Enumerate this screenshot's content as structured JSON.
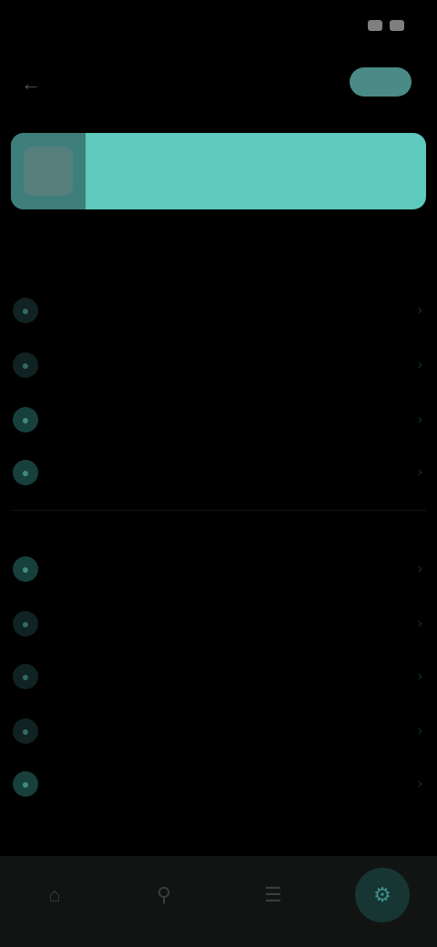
{
  "status_bar": {
    "time": "",
    "icons": [
      "signal-icon",
      "battery-icon"
    ]
  },
  "header": {
    "title": "",
    "action_label": ""
  },
  "current": {
    "label": ""
  },
  "sections": [
    {
      "header": "",
      "items": [
        {
          "label": "",
          "icon": "circle-icon"
        },
        {
          "label": "",
          "icon": "circle-icon"
        },
        {
          "label": "",
          "icon": "circle-icon"
        },
        {
          "label": "",
          "icon": "circle-icon"
        }
      ]
    },
    {
      "header": "",
      "items": [
        {
          "label": "",
          "icon": "circle-icon"
        },
        {
          "label": "",
          "icon": "circle-icon"
        },
        {
          "label": "",
          "icon": "circle-icon"
        },
        {
          "label": "",
          "icon": "circle-icon"
        },
        {
          "label": "",
          "icon": "circle-icon"
        }
      ]
    }
  ],
  "bottom_nav": {
    "items": [
      {
        "label": "",
        "icon": "home-icon"
      },
      {
        "label": "",
        "icon": "search-icon"
      },
      {
        "label": "",
        "icon": "library-icon"
      },
      {
        "label": "",
        "icon": "settings-icon"
      }
    ],
    "active_index": 3
  },
  "colors": {
    "background": "#000000",
    "accent": "#5ec9bc",
    "accent_dark": "#3f7f7b",
    "nav_bg": "#121414"
  }
}
